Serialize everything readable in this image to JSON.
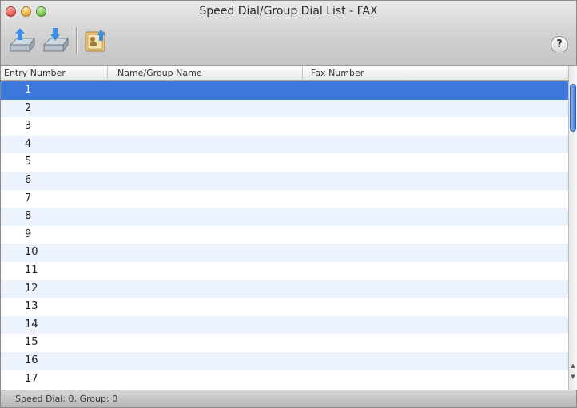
{
  "window": {
    "title": "Speed Dial/Group Dial List - FAX"
  },
  "toolbar": {
    "buttons": [
      {
        "icon": "fax-upload-icon"
      },
      {
        "icon": "fax-download-icon"
      },
      {
        "icon": "address-book-import-icon"
      }
    ],
    "help_label": "?"
  },
  "table": {
    "columns": [
      "Entry Number",
      "Name/Group Name",
      "Fax Number"
    ],
    "rows": [
      {
        "entry": "1",
        "name": "",
        "fax": ""
      },
      {
        "entry": "2",
        "name": "",
        "fax": ""
      },
      {
        "entry": "3",
        "name": "",
        "fax": ""
      },
      {
        "entry": "4",
        "name": "",
        "fax": ""
      },
      {
        "entry": "5",
        "name": "",
        "fax": ""
      },
      {
        "entry": "6",
        "name": "",
        "fax": ""
      },
      {
        "entry": "7",
        "name": "",
        "fax": ""
      },
      {
        "entry": "8",
        "name": "",
        "fax": ""
      },
      {
        "entry": "9",
        "name": "",
        "fax": ""
      },
      {
        "entry": "10",
        "name": "",
        "fax": ""
      },
      {
        "entry": "11",
        "name": "",
        "fax": ""
      },
      {
        "entry": "12",
        "name": "",
        "fax": ""
      },
      {
        "entry": "13",
        "name": "",
        "fax": ""
      },
      {
        "entry": "14",
        "name": "",
        "fax": ""
      },
      {
        "entry": "15",
        "name": "",
        "fax": ""
      },
      {
        "entry": "16",
        "name": "",
        "fax": ""
      },
      {
        "entry": "17",
        "name": "",
        "fax": ""
      }
    ],
    "selected_entry": "1"
  },
  "status": {
    "text": "Speed Dial: 0, Group: 0"
  },
  "colors": {
    "selection": "#3d79dc",
    "row_alt": "#edf3fe"
  }
}
